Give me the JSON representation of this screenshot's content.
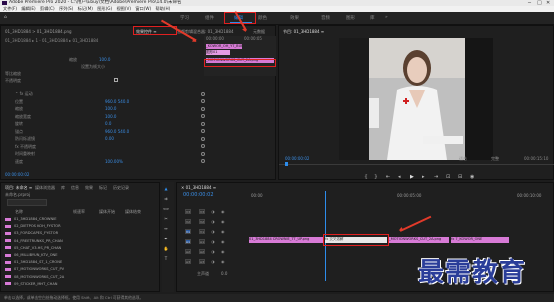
{
  "window": {
    "title": "Adobe Premiere Pro 2020 - C:\\用户\\Ebuy\\文档\\Adobe\\Premiere Pro\\14.0\\未命名",
    "controls": [
      "─",
      "□",
      "✕"
    ]
  },
  "menu": [
    "文件(F)",
    "编辑(E)",
    "剪辑(C)",
    "序列(S)",
    "标记(M)",
    "图形(G)",
    "视图(V)",
    "窗口(W)",
    "帮助(H)"
  ],
  "workspaces": {
    "home": "⌂",
    "tabs": [
      "学习",
      "组件",
      "编辑",
      "颜色",
      "效果",
      "音频",
      "图形",
      "库"
    ],
    "active_index": 2,
    "more": "»"
  },
  "effect_controls": {
    "tabs": [
      "效果控件 ≡",
      "音频剪辑混合器: 01_3HD1884",
      "元数据"
    ],
    "source_line": "01_3HD1884 > 01_3HD1884.png",
    "opacity_header": "不透明度",
    "timecode_start": "00:00:00",
    "sequence_label": "01_3HD1884 ▸ 1 - 01_3HD1884 ▸ 01_3HD1884",
    "scale_label": "缩放",
    "scale_value": "100.0",
    "fit_label": "设置为帧大小",
    "aspect_label": "等比缩放",
    "props": [
      {
        "label": "⌃ fx 运动",
        "value": ""
      },
      {
        "label": "位置",
        "value": "960.0  540.0"
      },
      {
        "label": "缩放",
        "value": "100.0"
      },
      {
        "label": "缩放宽度",
        "value": "100.0"
      },
      {
        "label": "旋转",
        "value": "0.0"
      },
      {
        "label": "锚点",
        "value": "960.0  540.0"
      },
      {
        "label": "防闪烁滤镜",
        "value": "0.00"
      },
      {
        "label": "fx 不透明度",
        "value": ""
      },
      {
        "label": "时间重映射",
        "value": ""
      },
      {
        "label": "速度",
        "value": "100.00%"
      }
    ],
    "mini_clips": [
      "图形01",
      "_KOWOR_OH_YT_BURAKBLE_1A.png",
      "_MOTIONWORKS_CUT_2A.png"
    ],
    "mini_timecodes": [
      "00:00:00",
      "00:00:05"
    ],
    "bottom_timecode": "00:00:00:02"
  },
  "program": {
    "tab": "节目: 01_3HD1884 ≡",
    "timecode": "00:00:00:02",
    "fit": "适合",
    "quality": "完整",
    "duration": "00:00:15:10",
    "buttons": [
      "标记入点",
      "标记出点",
      "转到入点",
      "后退一帧",
      "播放",
      "前进一帧",
      "转到出点",
      "插入",
      "覆盖",
      "导出帧"
    ]
  },
  "project": {
    "tabs": [
      "项目: 未命名 ≡",
      "媒体浏览器",
      "库",
      "信息",
      "效果",
      "标记",
      "历史记录"
    ],
    "name": "未命名.prproj",
    "columns": [
      "名称",
      "帧速率",
      "媒体开始",
      "媒体结束"
    ],
    "items": [
      "01_3HD1884_CROWNIE",
      "02_DIETPOS KOH_FYSTOR",
      "03_FORDCAPES_FYSTOR",
      "04_FREETRUNKS_PR_CHAN",
      "05_CHAT_V3.HS_PR_CHAN",
      "06_MILLIBYUN_KTV_ONE",
      "01_3HD1884_ST_1_CRONE",
      "07_MOTIONWORKS_CUT_PV",
      "08_MOTIONWORKS_CUT_2A",
      "09_STICKER_MHT_CHAN"
    ]
  },
  "timeline": {
    "tab": "✕  01_3HD1884 ≡",
    "timecode": "00:00:00:02",
    "ruler": [
      "00:00",
      "00:00:05:00",
      "00:00:10:00"
    ],
    "tracks": [
      "V3",
      "V2",
      "V1",
      "A1",
      "A2",
      "A3"
    ],
    "clips": [
      "01_3HD1884 CROWNIE_TT_UP.png",
      "fx 交叉溶解",
      "_MOTIONWORKS_CUT_2A.png",
      "fx 7_KOWOR_ONE"
    ],
    "master": "主声道",
    "master_value": "0.0"
  },
  "status": "单击以选择，或单击空白处拖动选择框。使用 Shift、Alt 和 Ctrl 可获得其他选项。",
  "watermark": "最需教育",
  "colors": {
    "accent": "#2d8ceb",
    "clip": "#d77ad6",
    "highlight": "#e02020"
  }
}
